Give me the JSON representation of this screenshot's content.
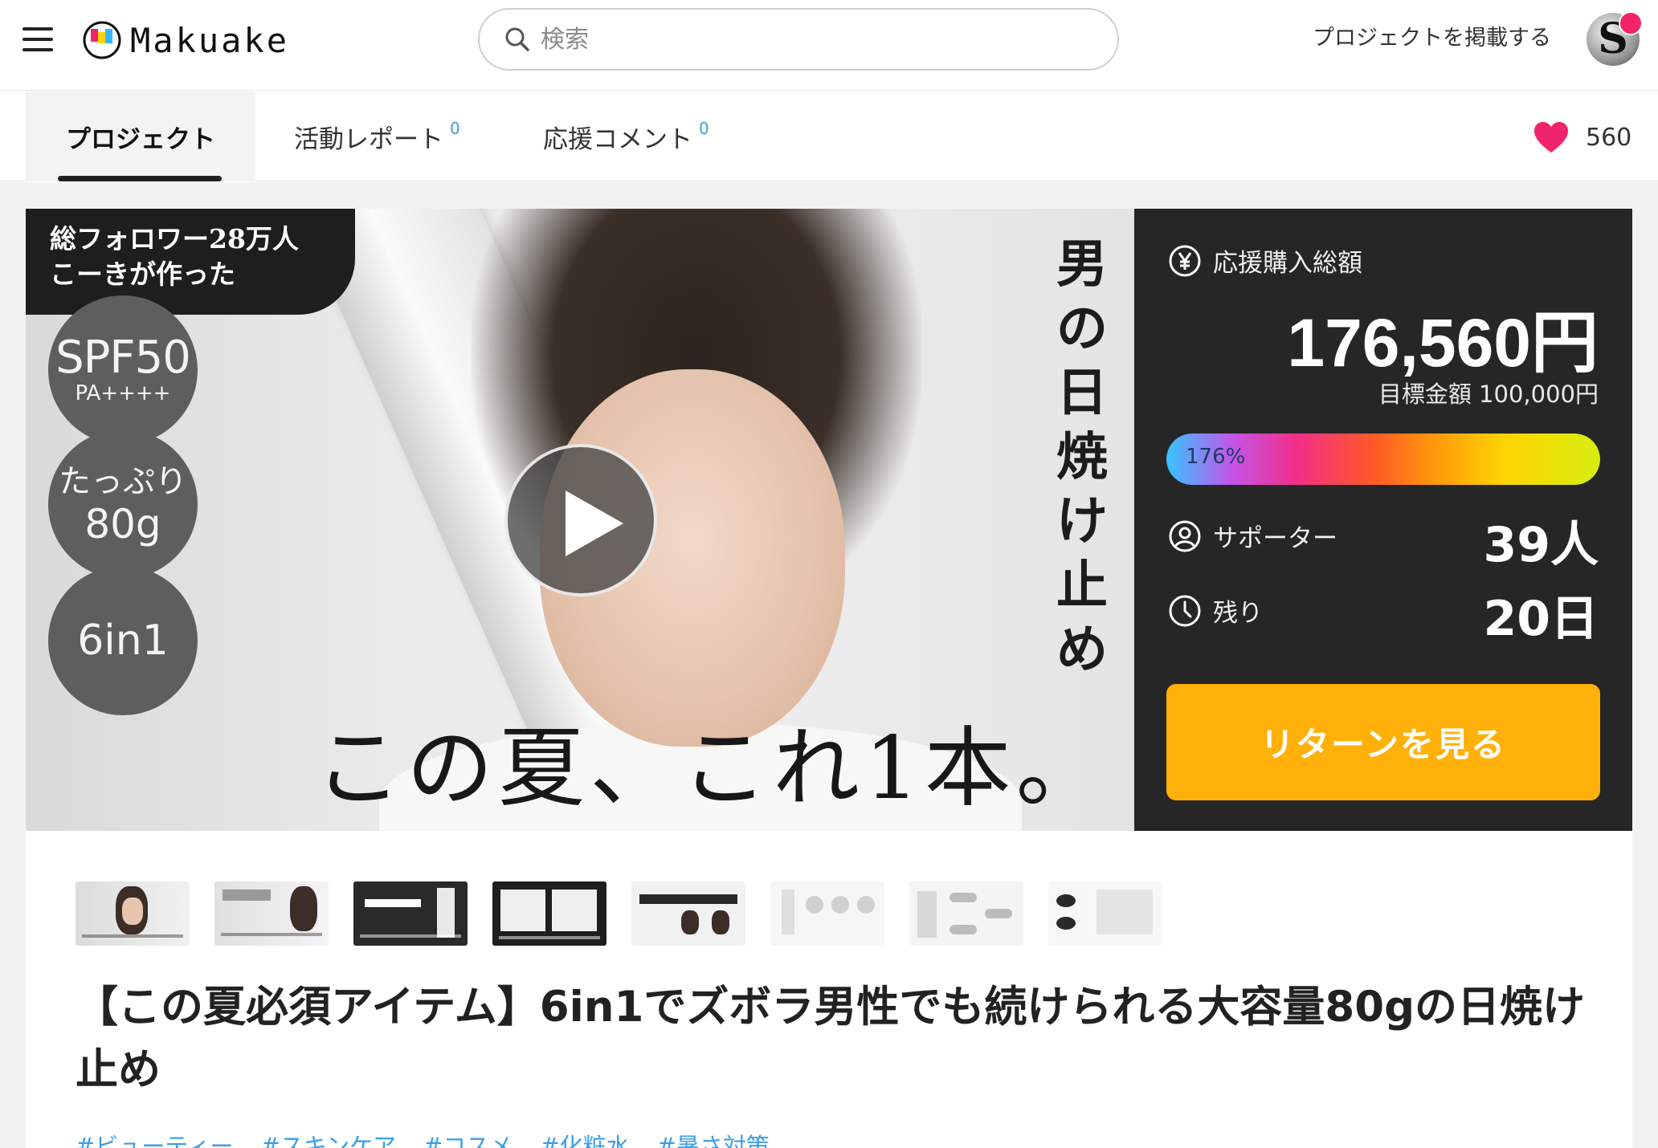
{
  "header": {
    "logo_text": "Makuake",
    "search_placeholder": "検索",
    "post_project_label": "プロジェクトを掲載する"
  },
  "tabs": [
    {
      "label": "プロジェクト",
      "count": ""
    },
    {
      "label": "活動レポート",
      "count": "0"
    },
    {
      "label": "応援コメント",
      "count": "0"
    }
  ],
  "likes": {
    "count": "560"
  },
  "hero": {
    "follower_badge_line1": "総フォロワー28万人",
    "follower_badge_line2": "こーきが作った",
    "badge_spf_main": "SPF50",
    "badge_spf_sub": "PA++++",
    "badge_volume_top": "たっぷり",
    "badge_volume_bottom": "80g",
    "badge_6in1": "6in1",
    "vertical_copy": [
      "男",
      "の",
      "日",
      "焼",
      "け",
      "止",
      "め"
    ],
    "slogan": "この夏、これ1本。"
  },
  "stats": {
    "total_label": "応援購入総額",
    "total_amount": "176,560円",
    "goal_text": "目標金額 100,000円",
    "progress_text": "176%",
    "progress_percent": 176,
    "supporters_label": "サポーター",
    "supporters_value": "39人",
    "remaining_label": "残り",
    "remaining_value": "20日",
    "cta_label": "リターンを見る"
  },
  "colors": {
    "accent_yellow": "#ffb10a",
    "panel_bg": "#262626",
    "heart": "#f0246a",
    "tag_blue": "#3a9ee8"
  },
  "thumbnails_count": 8,
  "title": "【この夏必須アイテム】6in1でズボラ男性でも続けられる大容量80gの日焼け止め",
  "tags": [
    "#ビューティー",
    "#スキンケア",
    "#コスメ",
    "#化粧水",
    "#暑さ対策"
  ]
}
